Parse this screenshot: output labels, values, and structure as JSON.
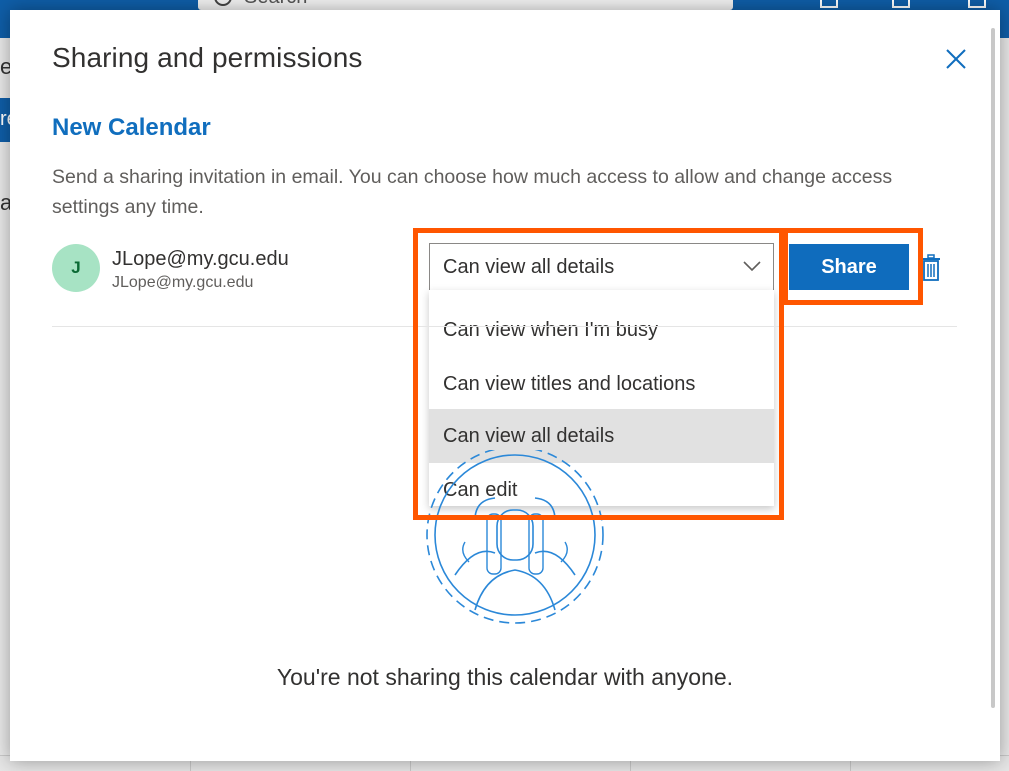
{
  "background": {
    "search_placeholder": "Search",
    "left_fragments": [
      "e",
      "re",
      "ay"
    ]
  },
  "dialog": {
    "title": "Sharing and permissions",
    "calendar_name": "New Calendar",
    "description": "Send a sharing invitation in email. You can choose how much access to allow and change access settings any time.",
    "person": {
      "initial": "J",
      "name": "JLope@my.gcu.edu",
      "email": "JLope@my.gcu.edu"
    },
    "permission": {
      "selected": "Can view all details",
      "options": [
        "Can view when I'm busy",
        "Can view titles and locations",
        "Can view all details",
        "Can edit"
      ]
    },
    "share_label": "Share",
    "empty_message": "You're not sharing this calendar with anyone."
  },
  "colors": {
    "accent": "#0f6cbd",
    "highlight": "#ff5600",
    "avatar_bg": "#a7e3c4"
  },
  "icons": {
    "close": "close-icon",
    "chevron": "chevron-down-icon",
    "trash": "trash-icon",
    "illustration": "people-illustration"
  }
}
